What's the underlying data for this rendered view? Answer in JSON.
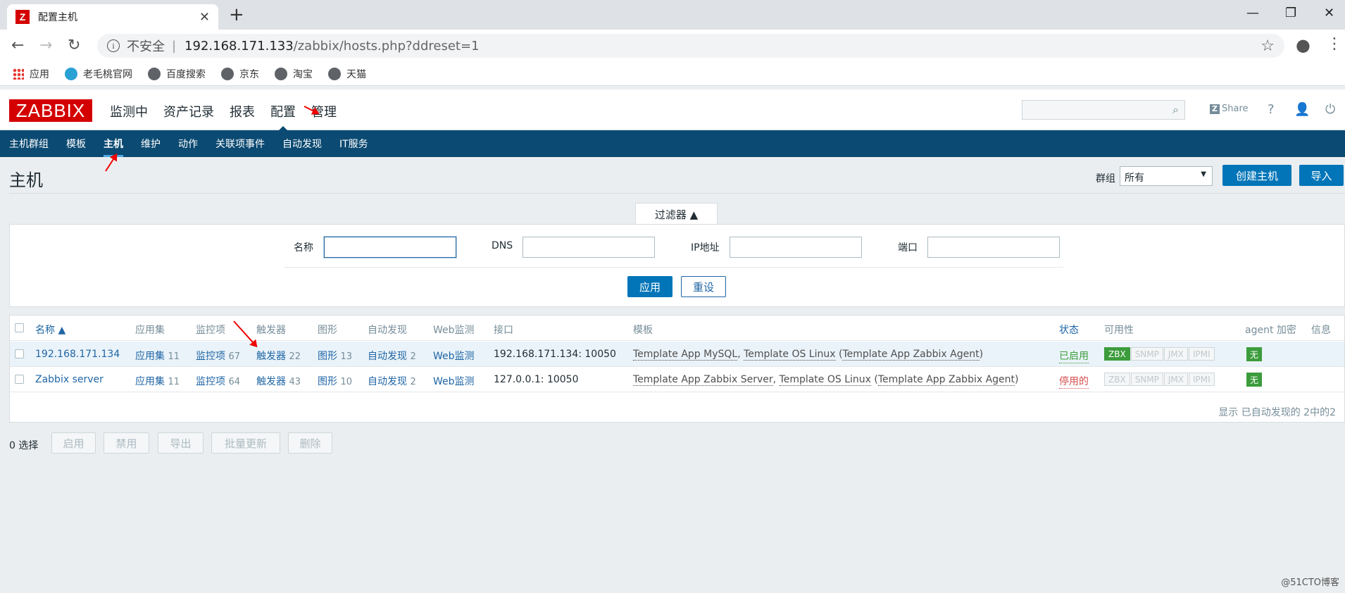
{
  "browser": {
    "tab_title": "配置主机",
    "favicon_letter": "Z",
    "security_label": "不安全",
    "url_host": "192.168.171.133",
    "url_path": "/zabbix/hosts.php?ddreset=1",
    "bookmarks": [
      "应用",
      "老毛桃官网",
      "百度搜索",
      "京东",
      "淘宝",
      "天猫"
    ]
  },
  "header": {
    "logo": "ZABBIX",
    "menu": [
      "监测中",
      "资产记录",
      "报表",
      "配置",
      "管理"
    ],
    "share": "Share"
  },
  "submenu": [
    "主机群组",
    "模板",
    "主机",
    "维护",
    "动作",
    "关联项事件",
    "自动发现",
    "IT服务"
  ],
  "page": {
    "title": "主机",
    "group_label": "群组",
    "group_value": "所有",
    "create_button": "创建主机",
    "import_button": "导入"
  },
  "filter": {
    "tab_label": "过滤器 ▲",
    "name_label": "名称",
    "dns_label": "DNS",
    "ip_label": "IP地址",
    "port_label": "端口",
    "apply": "应用",
    "reset": "重设"
  },
  "table": {
    "headers": {
      "name": "名称 ▲",
      "apps": "应用集",
      "items": "监控项",
      "triggers": "触发器",
      "graphs": "图形",
      "discovery": "自动发现",
      "web": "Web监测",
      "interface": "接口",
      "templates": "模板",
      "status": "状态",
      "availability": "可用性",
      "encryption": "agent 加密",
      "info": "信息"
    },
    "rows": [
      {
        "name": "192.168.171.134",
        "apps": "应用集",
        "apps_count": "11",
        "items": "监控项",
        "items_count": "67",
        "triggers": "触发器",
        "triggers_count": "22",
        "graphs": "图形",
        "graphs_count": "13",
        "discovery": "自动发现",
        "discovery_count": "2",
        "web": "Web监测",
        "interface": "192.168.171.134: 10050",
        "t1": "Template App MySQL",
        "t2": "Template OS Linux",
        "t3": "Template App Zabbix Agent",
        "status": "已启用",
        "enc": "无"
      },
      {
        "name": "Zabbix server",
        "apps": "应用集",
        "apps_count": "11",
        "items": "监控项",
        "items_count": "64",
        "triggers": "触发器",
        "triggers_count": "43",
        "graphs": "图形",
        "graphs_count": "10",
        "discovery": "自动发现",
        "discovery_count": "2",
        "web": "Web监测",
        "interface": "127.0.0.1: 10050",
        "t1": "Template App Zabbix Server",
        "t2": "Template OS Linux",
        "t3": "Template App Zabbix Agent",
        "status": "停用的",
        "enc": "无"
      }
    ],
    "avail": [
      "ZBX",
      "SNMP",
      "JMX",
      "IPMI"
    ],
    "footer": "显示 已自动发现的 2中的2"
  },
  "actions": {
    "selected": "0 选择",
    "buttons": [
      "启用",
      "禁用",
      "导出",
      "批量更新",
      "删除"
    ]
  },
  "watermark": "@51CTO博客"
}
